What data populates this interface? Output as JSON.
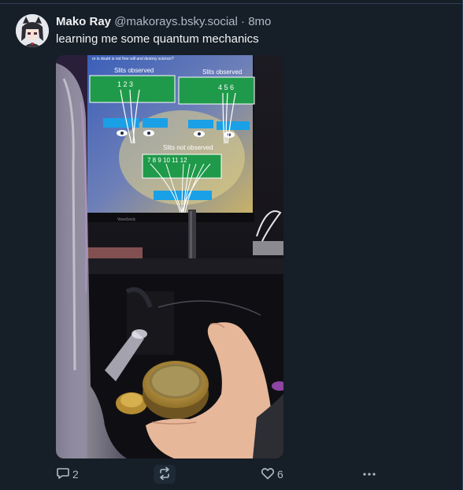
{
  "post": {
    "author": {
      "display_name": "Mako Ray",
      "handle": "@makorays.bsky.social"
    },
    "separator": "·",
    "timestamp": "8mo",
    "text": "learning me some quantum mechanics",
    "media": {
      "slide": {
        "heading_top": "or is doubt is not free will and destroy science?",
        "left_title": "Slits observed",
        "right_title": "Slits observed",
        "bottom_title": "Slits not observed",
        "left_numbers": "1  2  3",
        "right_numbers": "4 5   6",
        "bottom_numbers": "7     8      9 10 11 12"
      },
      "monitor_brand": "ViewSonic"
    },
    "actions": {
      "reply_count": "2",
      "like_count": "6"
    }
  },
  "colors": {
    "background": "#161e27",
    "text_primary": "#f1f3f5",
    "text_secondary": "#aebbc9",
    "divider": "#2e4052"
  },
  "icons": {
    "reply": "speech-bubble-icon",
    "repost": "repost-arrows-icon",
    "like": "heart-outline-icon",
    "more": "ellipsis-icon"
  }
}
